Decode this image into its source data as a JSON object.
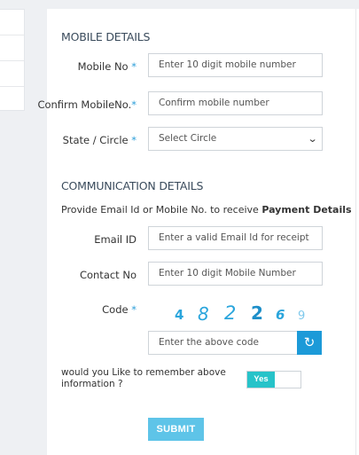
{
  "mobile_section": {
    "title": "MOBILE DETAILS",
    "mobile_label": "Mobile No",
    "mobile_placeholder": "Enter 10 digit mobile number",
    "confirm_label": "Confirm MobileNo.",
    "confirm_placeholder": "Confirm mobile number",
    "state_label": "State / Circle",
    "state_value": "Select Circle",
    "required_marker": "*"
  },
  "communication_section": {
    "title": "COMMUNICATION DETAILS",
    "info_prefix": "Provide Email Id or Mobile No. to receive ",
    "info_bold": "Payment Details",
    "email_label": "Email ID",
    "email_placeholder": "Enter a valid Email Id for receipt",
    "contact_label": "Contact No",
    "contact_placeholder": "Enter 10 digit Mobile Number",
    "code_label": "Code",
    "captcha_digits": [
      "4",
      "8",
      "2",
      "2",
      "6",
      "9"
    ],
    "captcha_placeholder": "Enter the above code",
    "refresh_icon": "refresh-icon",
    "remember_text": "would you Like to remember above information ?",
    "toggle_label": "Yes",
    "submit_label": "SUBMIT"
  },
  "colors": {
    "accent": "#2d9fd9",
    "toggle_on": "#27c3c9",
    "submit_bg": "#5ec4e8"
  }
}
